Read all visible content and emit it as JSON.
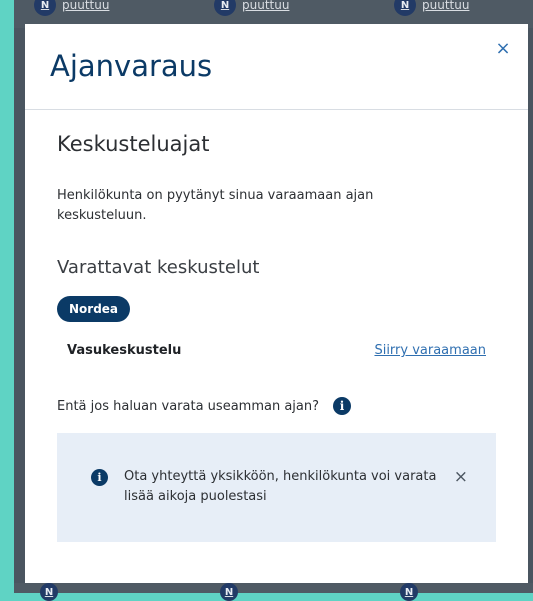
{
  "background": {
    "top_chips": [
      "puuttuu",
      "puuttuu",
      "puuttuu"
    ],
    "chip_initial": "N",
    "bottom_chips": [
      "N",
      "N",
      "N"
    ]
  },
  "modal": {
    "title": "Ajanvaraus",
    "close_icon": "×",
    "section_title": "Keskusteluajat",
    "intro": "Henkilökunta on pyytänyt sinua varaamaan ajan keskusteluun.",
    "subheading": "Varattavat keskustelut",
    "organization": "Nordea",
    "conversation": {
      "name": "Vasukeskustelu",
      "action_link": "Siirry varaamaan"
    },
    "question": "Entä jos haluan varata useamman ajan?",
    "info_icon": "i",
    "info_box": {
      "text": "Ota yhteyttä yksikköön, henkilökunta voi varata lisää aikoja puolestasi",
      "close_icon": "×"
    }
  },
  "colors": {
    "accent": "#0b3a66",
    "link": "#2f6fb0",
    "info_bg": "#e7eef7",
    "page_bg": "#5fd3c4"
  }
}
